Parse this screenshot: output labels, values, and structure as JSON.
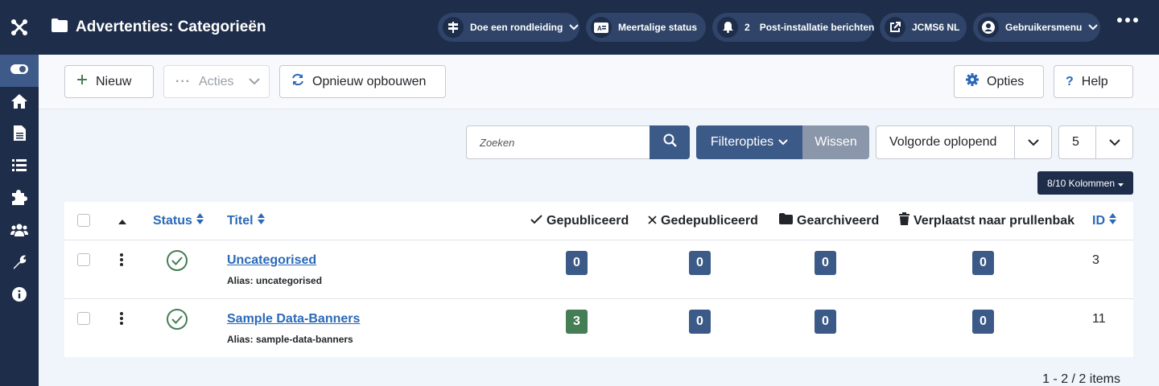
{
  "header": {
    "title": "Advertenties: Categorieën",
    "tour_label": "Doe een rondleiding",
    "multilingual_label": "Meertalige status",
    "postinstall_count": "2",
    "postinstall_label": "Post-installatie berichten",
    "site_label": "JCMS6 NL",
    "user_menu_label": "Gebruikersmenu"
  },
  "sidebar": {
    "items": [
      "toggle",
      "home",
      "content",
      "menus",
      "components",
      "users",
      "system",
      "help"
    ]
  },
  "toolbar": {
    "new_label": "Nieuw",
    "actions_label": "Acties",
    "rebuild_label": "Opnieuw opbouwen",
    "options_label": "Opties",
    "help_label": "Help"
  },
  "filters": {
    "search_placeholder": "Zoeken",
    "filter_options_label": "Filteropties",
    "clear_label": "Wissen",
    "ordering_value": "Volgorde oplopend",
    "limit_value": "5",
    "columns_label": "8/10 Kolommen"
  },
  "table": {
    "headers": {
      "status": "Status",
      "title": "Titel",
      "published": "Gepubliceerd",
      "unpublished": "Gedepubliceerd",
      "archived": "Gearchiveerd",
      "trashed": "Verplaatst naar prullenbak",
      "id": "ID"
    },
    "rows": [
      {
        "title": "Uncategorised",
        "alias": "Alias: uncategorised",
        "published": "0",
        "unpublished": "0",
        "archived": "0",
        "trashed": "0",
        "id": "3"
      },
      {
        "title": "Sample Data-Banners",
        "alias": "Alias: sample-data-banners",
        "published": "3",
        "unpublished": "0",
        "archived": "0",
        "trashed": "0",
        "id": "11"
      }
    ]
  },
  "pagination": {
    "info": "1 - 2 / 2 items"
  },
  "colors": {
    "navy": "#1e2d4a",
    "primary": "#3c5a88",
    "success": "#457d54",
    "link": "#2a69b8"
  }
}
